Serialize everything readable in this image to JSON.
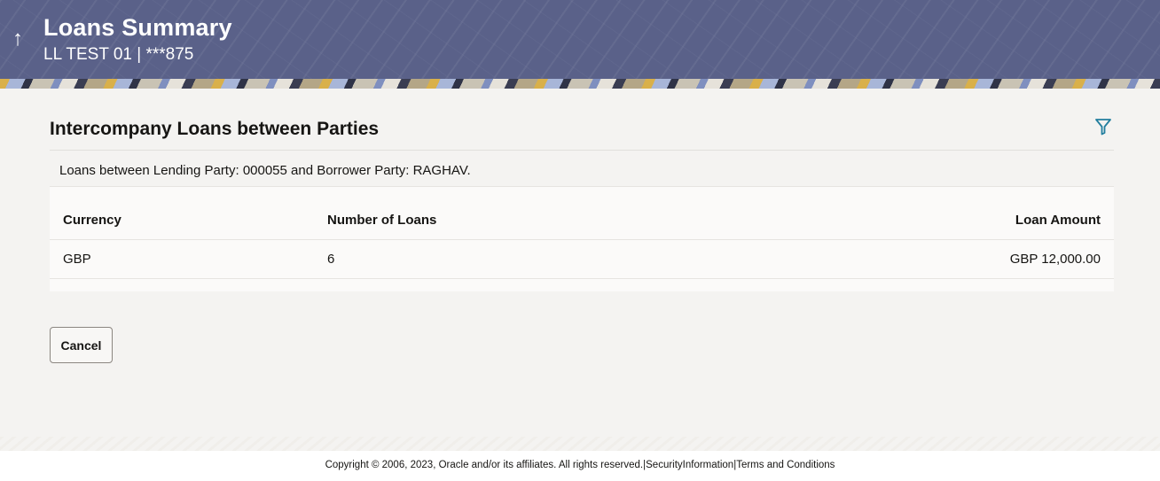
{
  "header": {
    "back_icon": "up-arrow-icon",
    "title": "Loans Summary",
    "subtitle": "LL TEST 01 | ***875"
  },
  "section": {
    "title": "Intercompany Loans between Parties",
    "filter_icon": "filter-icon",
    "info": "Loans between Lending Party: 000055 and Borrower Party: RAGHAV."
  },
  "table": {
    "columns": [
      "Currency",
      "Number of Loans",
      "Loan Amount"
    ],
    "rows": [
      {
        "currency": "GBP",
        "number_of_loans": "6",
        "loan_amount": "GBP 12,000.00"
      }
    ]
  },
  "actions": {
    "cancel_label": "Cancel"
  },
  "footer": {
    "copyright": "Copyright © 2006, 2023, Oracle and/or its affiliates. All rights reserved.",
    "separator": "|",
    "security_link": "SecurityInformation",
    "terms_link": "Terms and Conditions"
  },
  "colors": {
    "header_bg": "#5a6189",
    "page_bg": "#f4f3f1",
    "accent": "#227e9e"
  }
}
